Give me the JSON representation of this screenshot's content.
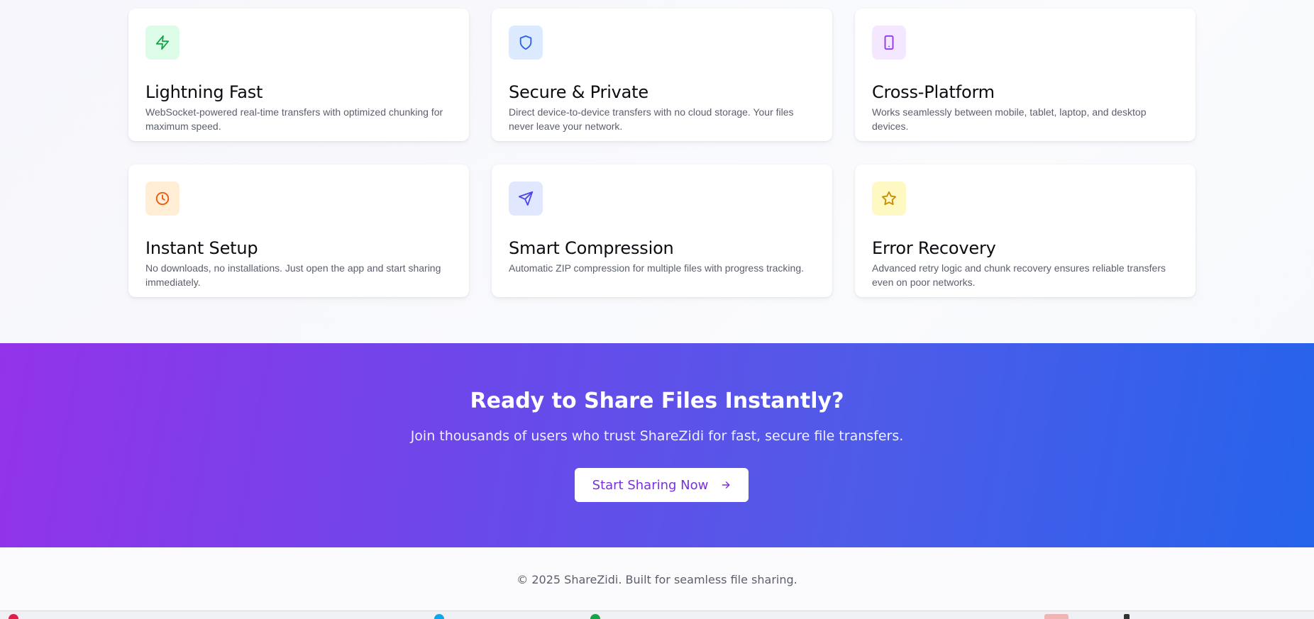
{
  "features": [
    {
      "title": "Lightning Fast",
      "description": "WebSocket-powered real-time transfers with optimized chunking for maximum speed.",
      "icon": "lightning-icon",
      "icon_color": "#16a34a",
      "icon_bg": "#dcfce7"
    },
    {
      "title": "Secure & Private",
      "description": "Direct device-to-device transfers with no cloud storage. Your files never leave your network.",
      "icon": "shield-icon",
      "icon_color": "#2563eb",
      "icon_bg": "#dbeafe"
    },
    {
      "title": "Cross-Platform",
      "description": "Works seamlessly between mobile, tablet, laptop, and desktop devices.",
      "icon": "tablet-icon",
      "icon_color": "#9333ea",
      "icon_bg": "#f3e8ff"
    },
    {
      "title": "Instant Setup",
      "description": "No downloads, no installations. Just open the app and start sharing immediately.",
      "icon": "clock-icon",
      "icon_color": "#ea580c",
      "icon_bg": "#ffedd5"
    },
    {
      "title": "Smart Compression",
      "description": "Automatic ZIP compression for multiple files with progress tracking.",
      "icon": "send-icon",
      "icon_color": "#4f46e5",
      "icon_bg": "#e0e7ff"
    },
    {
      "title": "Error Recovery",
      "description": "Advanced retry logic and chunk recovery ensures reliable transfers even on poor networks.",
      "icon": "star-icon",
      "icon_color": "#ca8a04",
      "icon_bg": "#fef9c3"
    }
  ],
  "cta": {
    "heading": "Ready to Share Files Instantly?",
    "subheading": "Join thousands of users who trust ShareZidi for fast, secure file transfers.",
    "button_label": "Start Sharing Now",
    "button_icon": "arrow-right-icon",
    "gradient_start": "#9333ea",
    "gradient_end": "#2563eb"
  },
  "footer": {
    "copyright": "© 2025 ShareZidi. Built for seamless file sharing."
  }
}
